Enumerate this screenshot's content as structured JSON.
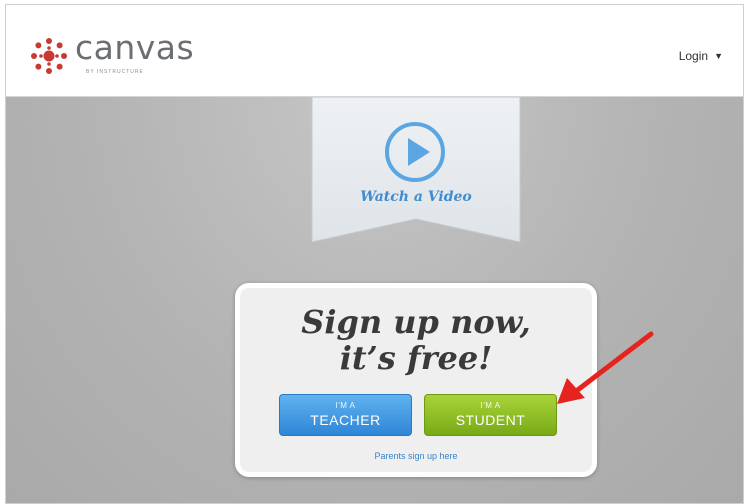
{
  "header": {
    "logo_word": "canvas",
    "logo_sub": "BY INSTRUCTURE",
    "login_label": "Login",
    "login_caret": "▼"
  },
  "video": {
    "label": "Watch a Video",
    "icon": "play-circle-icon"
  },
  "signup": {
    "headline_line1": "Sign up now,",
    "headline_line2": "it’s free!",
    "teacher_small": "I'M A",
    "teacher_big": "TEACHER",
    "student_small": "I'M A",
    "student_big": "STUDENT",
    "parents_link": "Parents sign up here"
  },
  "colors": {
    "brand_red": "#c63a32",
    "teacher_blue": "#3a8fdc",
    "student_green": "#8cc12a",
    "link_blue": "#3a84c9",
    "annotation_red": "#e52420"
  }
}
